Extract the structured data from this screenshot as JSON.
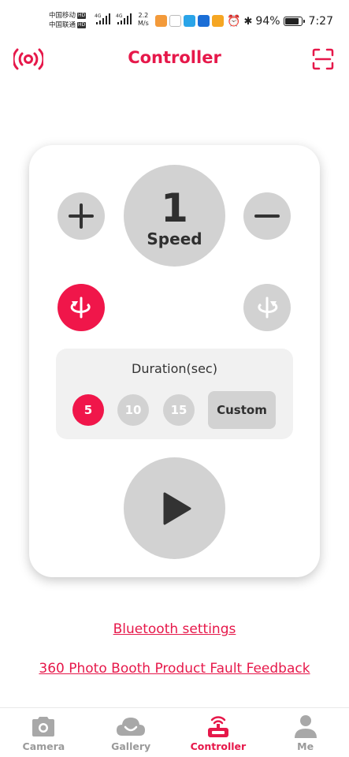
{
  "status_bar": {
    "carrier1": "中国移动",
    "carrier2": "中国联通",
    "hd_badge": "HD",
    "net_type": "4G",
    "net_speed_value": "2.2",
    "net_speed_unit": "M/s",
    "battery": "94%",
    "time": "7:27"
  },
  "header": {
    "title": "Controller",
    "left_icon": "broadcast-icon",
    "right_icon": "scan-icon"
  },
  "controller": {
    "speed_value": "1",
    "speed_label": "Speed",
    "duration_title": "Duration(sec)",
    "duration_options": [
      "5",
      "10",
      "15"
    ],
    "selected_duration": "5",
    "custom_label": "Custom"
  },
  "links": {
    "bluetooth": "Bluetooth settings",
    "feedback": "360 Photo Booth Product Fault Feedback"
  },
  "nav": {
    "items": [
      {
        "label": "Camera",
        "icon": "camera-icon"
      },
      {
        "label": "Gallery",
        "icon": "gallery-icon"
      },
      {
        "label": "Controller",
        "icon": "controller-icon"
      },
      {
        "label": "Me",
        "icon": "person-icon"
      }
    ],
    "active": "Controller"
  },
  "colors": {
    "accent": "#e6184a",
    "button_gray": "#d2d2d2",
    "panel_gray": "#f1f1f1",
    "dark_text": "#2f2f2f"
  }
}
